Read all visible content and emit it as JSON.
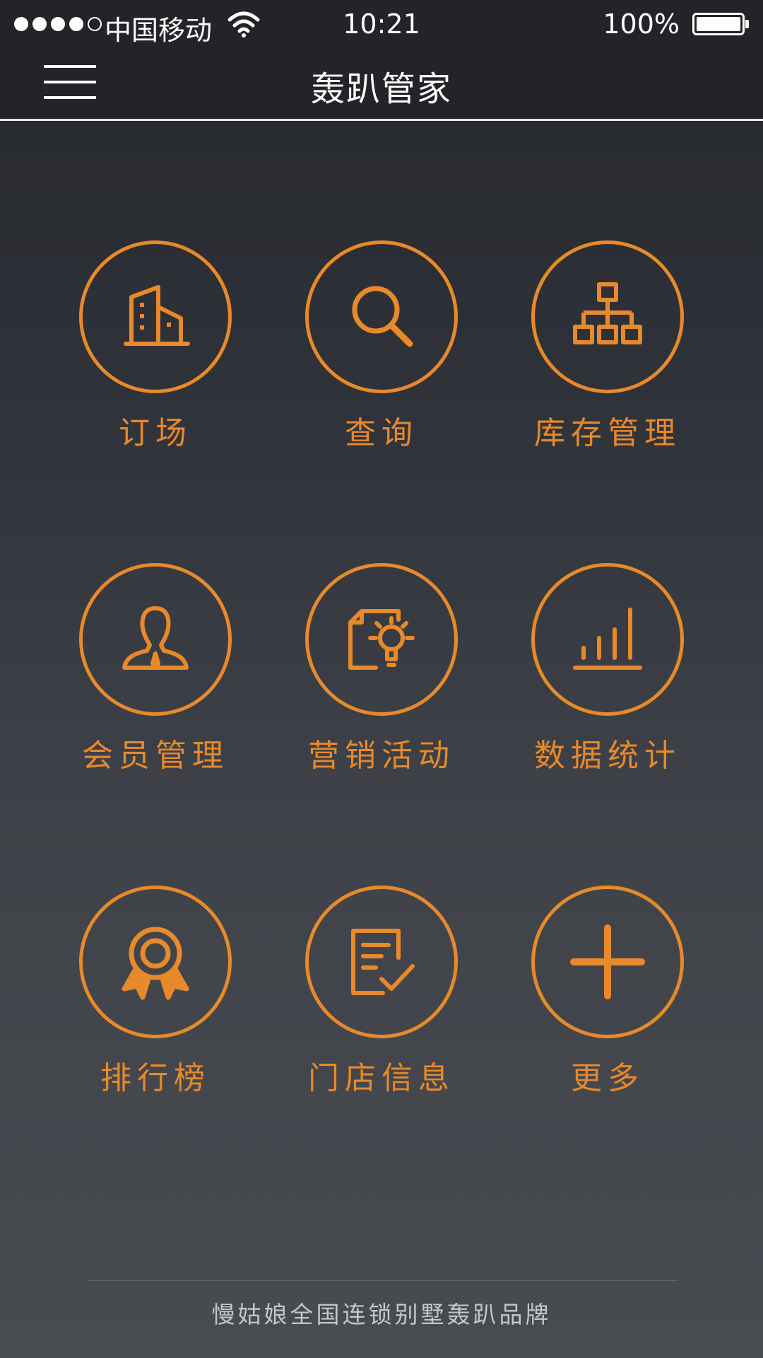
{
  "status_bar": {
    "carrier": "中国移动",
    "time": "10:21",
    "battery_percent": "100%",
    "signal_bars": 4,
    "signal_total": 5,
    "battery_level": 1.0
  },
  "header": {
    "title": "轰趴管家",
    "menu_icon": "hamburger-menu-icon"
  },
  "colors": {
    "accent": "#e8892a",
    "bar_background": "#232428",
    "text": "#ffffff"
  },
  "menu": {
    "items": [
      {
        "label": "订场",
        "icon": "building-icon"
      },
      {
        "label": "查询",
        "icon": "search-icon"
      },
      {
        "label": "库存管理",
        "icon": "org-chart-icon"
      },
      {
        "label": "会员管理",
        "icon": "member-icon"
      },
      {
        "label": "营销活动",
        "icon": "idea-document-icon"
      },
      {
        "label": "数据统计",
        "icon": "bar-chart-icon"
      },
      {
        "label": "排行榜",
        "icon": "award-medal-icon"
      },
      {
        "label": "门店信息",
        "icon": "checked-document-icon"
      },
      {
        "label": "更多",
        "icon": "plus-icon"
      }
    ]
  },
  "footer": {
    "text": "慢姑娘全国连锁别墅轰趴品牌"
  }
}
